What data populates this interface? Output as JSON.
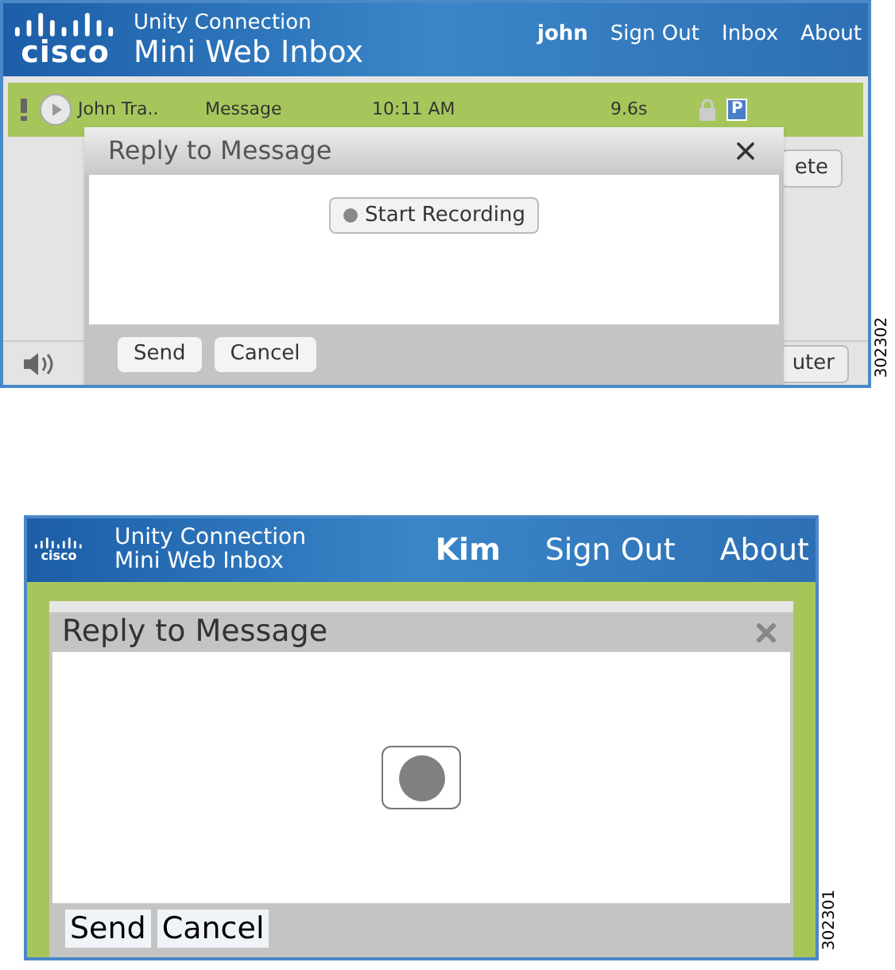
{
  "figures": [
    {
      "kind": "full",
      "header": {
        "logo": "cisco",
        "product": "Unity Connection",
        "app": "Mini Web Inbox",
        "user": "john",
        "links": [
          "Sign Out",
          "Inbox",
          "About"
        ]
      },
      "message": {
        "sender": "John Tra..",
        "subject": "Message",
        "time": "10:11 AM",
        "duration": "9.6s",
        "badge": "P"
      },
      "partial_buttons": [
        "ete",
        "uter"
      ],
      "dialog": {
        "title": "Reply to Message",
        "record_label": "Start Recording",
        "buttons": [
          "Send",
          "Cancel"
        ]
      },
      "figure_number": "302302"
    },
    {
      "kind": "compact",
      "header": {
        "logo": "cisco",
        "product": "Unity Connection",
        "app": "Mini Web Inbox",
        "user": "Kim",
        "links": [
          "Sign Out",
          "About"
        ]
      },
      "dialog": {
        "title": "Reply to Message",
        "buttons": [
          "Send",
          "Cancel"
        ]
      },
      "figure_number": "302301"
    }
  ]
}
